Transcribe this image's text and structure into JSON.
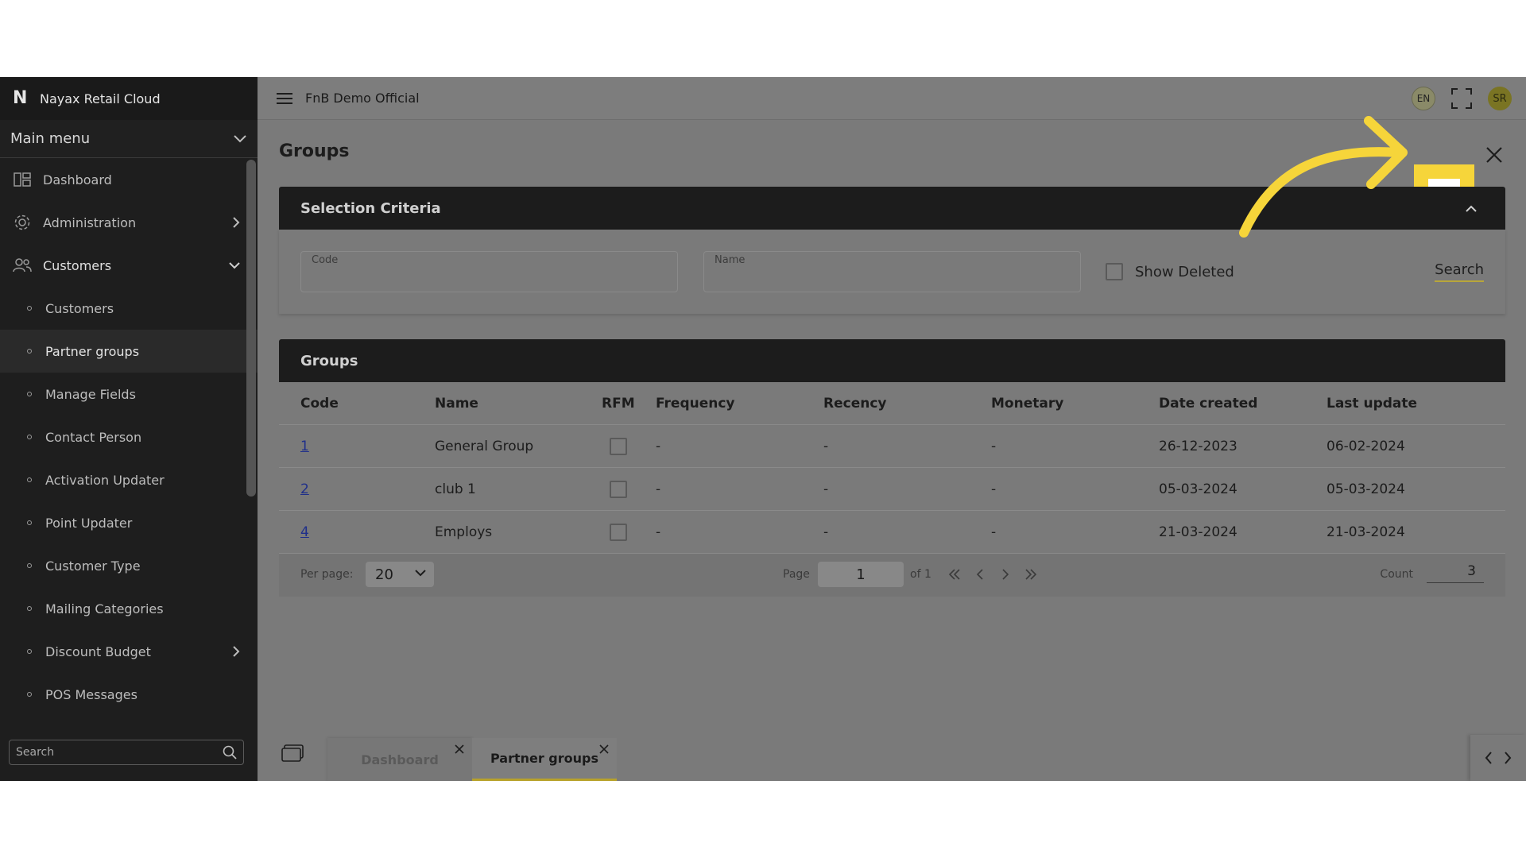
{
  "app": {
    "brand": "Nayax Retail Cloud",
    "org": "FnB Demo Official",
    "lang": "EN",
    "user_initials": "SR"
  },
  "sidebar": {
    "main_menu": "Main menu",
    "items": [
      {
        "label": "Dashboard",
        "icon": "dashboard-icon"
      },
      {
        "label": "Administration",
        "icon": "gear-icon"
      },
      {
        "label": "Customers",
        "icon": "users-icon"
      }
    ],
    "subitems": [
      "Customers",
      "Partner groups",
      "Manage Fields",
      "Contact Person",
      "Activation Updater",
      "Point Updater",
      "Customer Type",
      "Mailing Categories",
      "Discount Budget",
      "POS Messages"
    ],
    "search_placeholder": "Search"
  },
  "page": {
    "title": "Groups"
  },
  "criteria": {
    "title": "Selection Criteria",
    "code_label": "Code",
    "name_label": "Name",
    "show_deleted": "Show Deleted",
    "search": "Search"
  },
  "groups": {
    "title": "Groups",
    "columns": [
      "Code",
      "Name",
      "RFM",
      "Frequency",
      "Recency",
      "Monetary",
      "Date created",
      "Last update"
    ],
    "rows": [
      {
        "code": "1",
        "name": "General Group",
        "frequency": "-",
        "recency": "-",
        "monetary": "-",
        "created": "26-12-2023",
        "updated": "06-02-2024"
      },
      {
        "code": "2",
        "name": "club 1",
        "frequency": "-",
        "recency": "-",
        "monetary": "-",
        "created": "05-03-2024",
        "updated": "05-03-2024"
      },
      {
        "code": "4",
        "name": "Employs",
        "frequency": "-",
        "recency": "-",
        "monetary": "-",
        "created": "21-03-2024",
        "updated": "21-03-2024"
      }
    ],
    "per_page_label": "Per page:",
    "per_page": "20",
    "page_label": "Page",
    "page": "1",
    "of_label": "of 1",
    "count_label": "Count",
    "count": "3"
  },
  "tabs": [
    {
      "label": "Dashboard"
    },
    {
      "label": "Partner groups"
    }
  ],
  "colors": {
    "highlight": "#f6d53a",
    "sidebar": "#1e1e1e",
    "link": "#1f2f8a"
  }
}
